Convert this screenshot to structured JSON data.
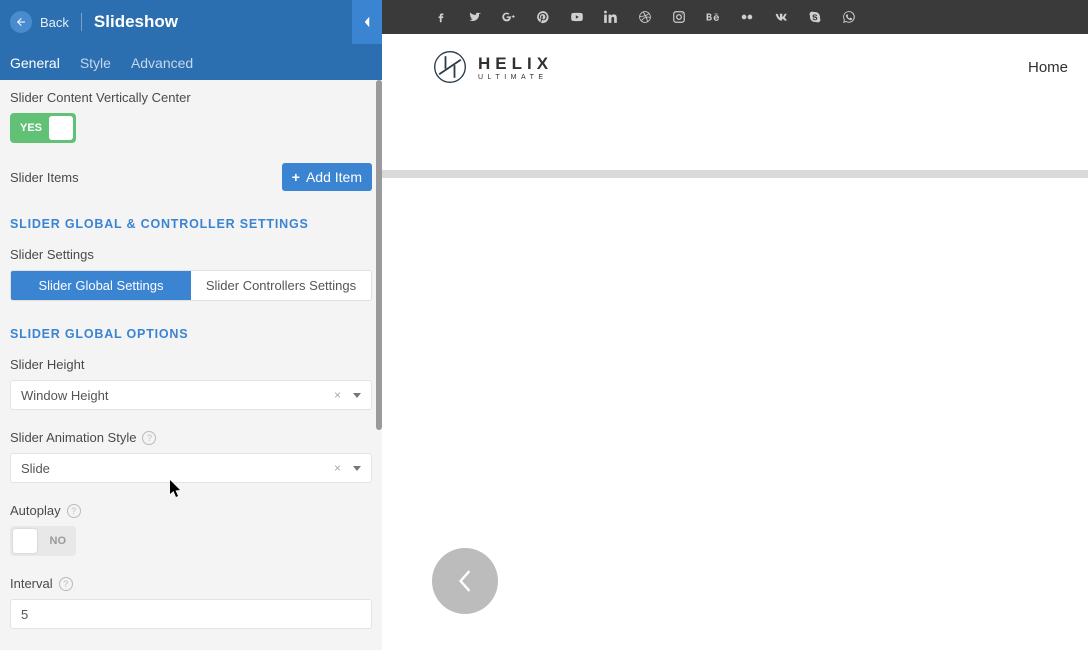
{
  "header": {
    "back_label": "Back",
    "title": "Slideshow"
  },
  "tabs": {
    "general": "General",
    "style": "Style",
    "advanced": "Advanced"
  },
  "fields": {
    "vcenter_label": "Slider Content Vertically Center",
    "vcenter_toggle": "YES",
    "slider_items_label": "Slider Items",
    "add_item_label": "Add Item",
    "section_global_controller": "SLIDER GLOBAL & CONTROLLER SETTINGS",
    "slider_settings_label": "Slider Settings",
    "seg_global": "Slider Global Settings",
    "seg_controllers": "Slider Controllers Settings",
    "section_global_options": "SLIDER GLOBAL OPTIONS",
    "slider_height_label": "Slider Height",
    "slider_height_value": "Window Height",
    "slider_anim_label": "Slider Animation Style",
    "slider_anim_value": "Slide",
    "autoplay_label": "Autoplay",
    "autoplay_toggle": "NO",
    "interval_label": "Interval",
    "interval_value": "5"
  },
  "preview": {
    "logo_line1": "HELIX",
    "logo_line2": "ULTIMATE",
    "nav_home": "Home"
  },
  "social_icons": [
    "facebook",
    "twitter",
    "googleplus",
    "pinterest",
    "youtube",
    "linkedin",
    "dribbble",
    "instagram",
    "behance",
    "flickr",
    "vk",
    "skype",
    "whatsapp"
  ]
}
